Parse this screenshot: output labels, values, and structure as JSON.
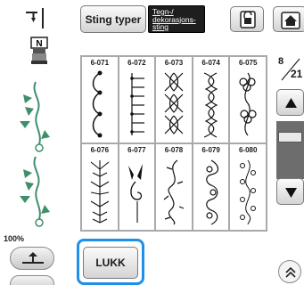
{
  "tabs": {
    "stitch_types": "Sting typer",
    "decorative_line1": "Tegn-/",
    "decorative_line2": "dekorasjons-",
    "decorative_line3": "sting"
  },
  "left_panel": {
    "zoom": "100%"
  },
  "page_indicator": {
    "current": "8",
    "total": "21"
  },
  "stitches": [
    {
      "code": "6-071"
    },
    {
      "code": "6-072"
    },
    {
      "code": "6-073"
    },
    {
      "code": "6-074"
    },
    {
      "code": "6-075"
    },
    {
      "code": "6-076"
    },
    {
      "code": "6-077"
    },
    {
      "code": "6-078"
    },
    {
      "code": "6-079"
    },
    {
      "code": "6-080"
    }
  ],
  "bottom": {
    "close_label": "LUKK"
  },
  "icons": {
    "needle": "needle-position-icon",
    "presser_foot": "presser-foot-N-icon",
    "lock": "lock-icon",
    "home": "home-icon",
    "scroll_up": "triangle-up-icon",
    "scroll_down": "triangle-down-icon",
    "expand": "double-chevron-up-icon",
    "reverse": "reverse-stitch-icon"
  },
  "colors": {
    "highlight": "#1e90e8",
    "selected_tab": "#1e1e1e",
    "grid_border": "#a9a9a9"
  }
}
